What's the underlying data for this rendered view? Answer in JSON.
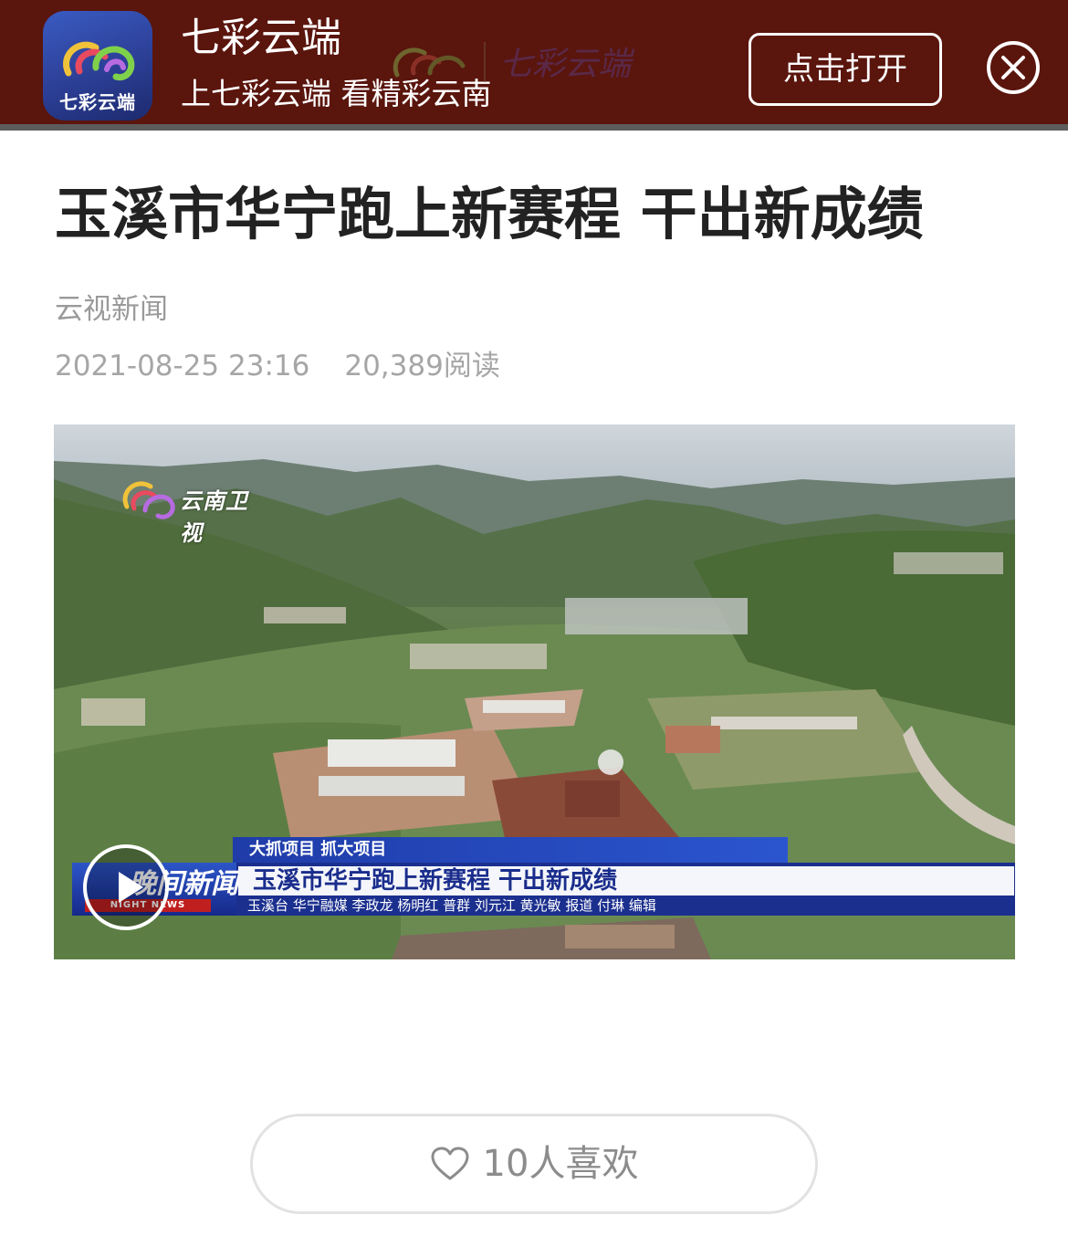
{
  "banner": {
    "app_name": "七彩云端",
    "logo_text": "七彩云端",
    "slogan": "上七彩云端 看精彩云南",
    "watermark_text": "七彩云端",
    "open_label": "点击打开",
    "close_icon": "close-circle-icon",
    "background_color": "#5a150d"
  },
  "article": {
    "title": "玉溪市华宁跑上新赛程 干出新成绩",
    "source": "云视新闻",
    "datetime": "2021-08-25 23:16",
    "reads": "20,389阅读"
  },
  "video": {
    "channel_logo_text": "云南卫视",
    "tag_line": "大抓项目 抓大项目",
    "brand": "晚间新闻",
    "brand_sub": "NIGHT NEWS",
    "headline": "玉溪市华宁跑上新赛程  干出新成绩",
    "credits": "玉溪台  华宁融媒  李政龙  杨明红  普群  刘元江  黄光敏  报道  付琳  编辑",
    "play_icon": "play-icon",
    "accent_color": "#1f3ca8"
  },
  "like": {
    "label": "10人喜欢",
    "icon": "heart-icon"
  }
}
